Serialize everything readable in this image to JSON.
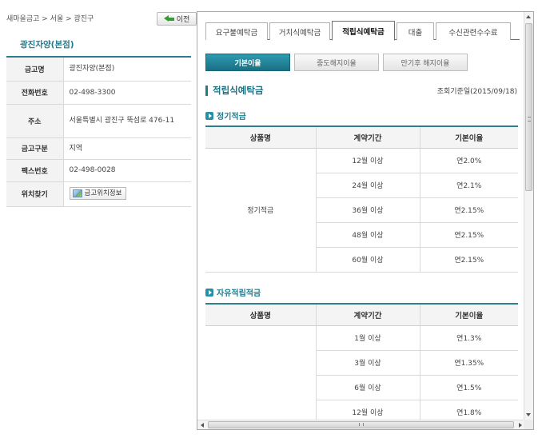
{
  "breadcrumb": "새마을금고 > 서울 > 광진구",
  "back_button": "이전",
  "branch": {
    "title": "광진자양(본점)",
    "rows": [
      {
        "label": "금고명",
        "value": "광진자양(본점)"
      },
      {
        "label": "전화번호",
        "value": "02-498-3300"
      },
      {
        "label": "주소",
        "value": "서울특별시 광진구 뚝섬로 476-11"
      },
      {
        "label": "금고구분",
        "value": "지역"
      },
      {
        "label": "팩스번호",
        "value": "02-498-0028"
      },
      {
        "label": "위치찾기",
        "value": "금고위치정보"
      }
    ]
  },
  "tabs": [
    "요구불예탁금",
    "거치식예탁금",
    "적립식예탁금",
    "대출",
    "수신관련수수료"
  ],
  "active_tab": "적립식예탁금",
  "subtabs": [
    "기본이율",
    "중도해지이율",
    "만기후 해지이율"
  ],
  "active_subtab": "기본이율",
  "section_title": "적립식예탁금",
  "reference_date": "조회기준일(2015/09/18)",
  "colors": {
    "accent": "#1d7d8f",
    "active_subtab": "#1f7f93"
  },
  "table_headers": [
    "상품명",
    "계약기간",
    "기본이율"
  ],
  "products": [
    {
      "name": "정기적금",
      "label": "정기적금",
      "rows": [
        {
          "period": "12월 이상",
          "rate": "연2.0%"
        },
        {
          "period": "24월 이상",
          "rate": "연2.1%"
        },
        {
          "period": "36월 이상",
          "rate": "연2.15%"
        },
        {
          "period": "48월 이상",
          "rate": "연2.15%"
        },
        {
          "period": "60월 이상",
          "rate": "연2.15%"
        }
      ]
    },
    {
      "name": "자유적립적금",
      "label": "",
      "rows": [
        {
          "period": "1월 이상",
          "rate": "연1.3%"
        },
        {
          "period": "3월 이상",
          "rate": "연1.35%"
        },
        {
          "period": "6월 이상",
          "rate": "연1.5%"
        },
        {
          "period": "12월 이상",
          "rate": "연1.8%"
        }
      ]
    }
  ]
}
